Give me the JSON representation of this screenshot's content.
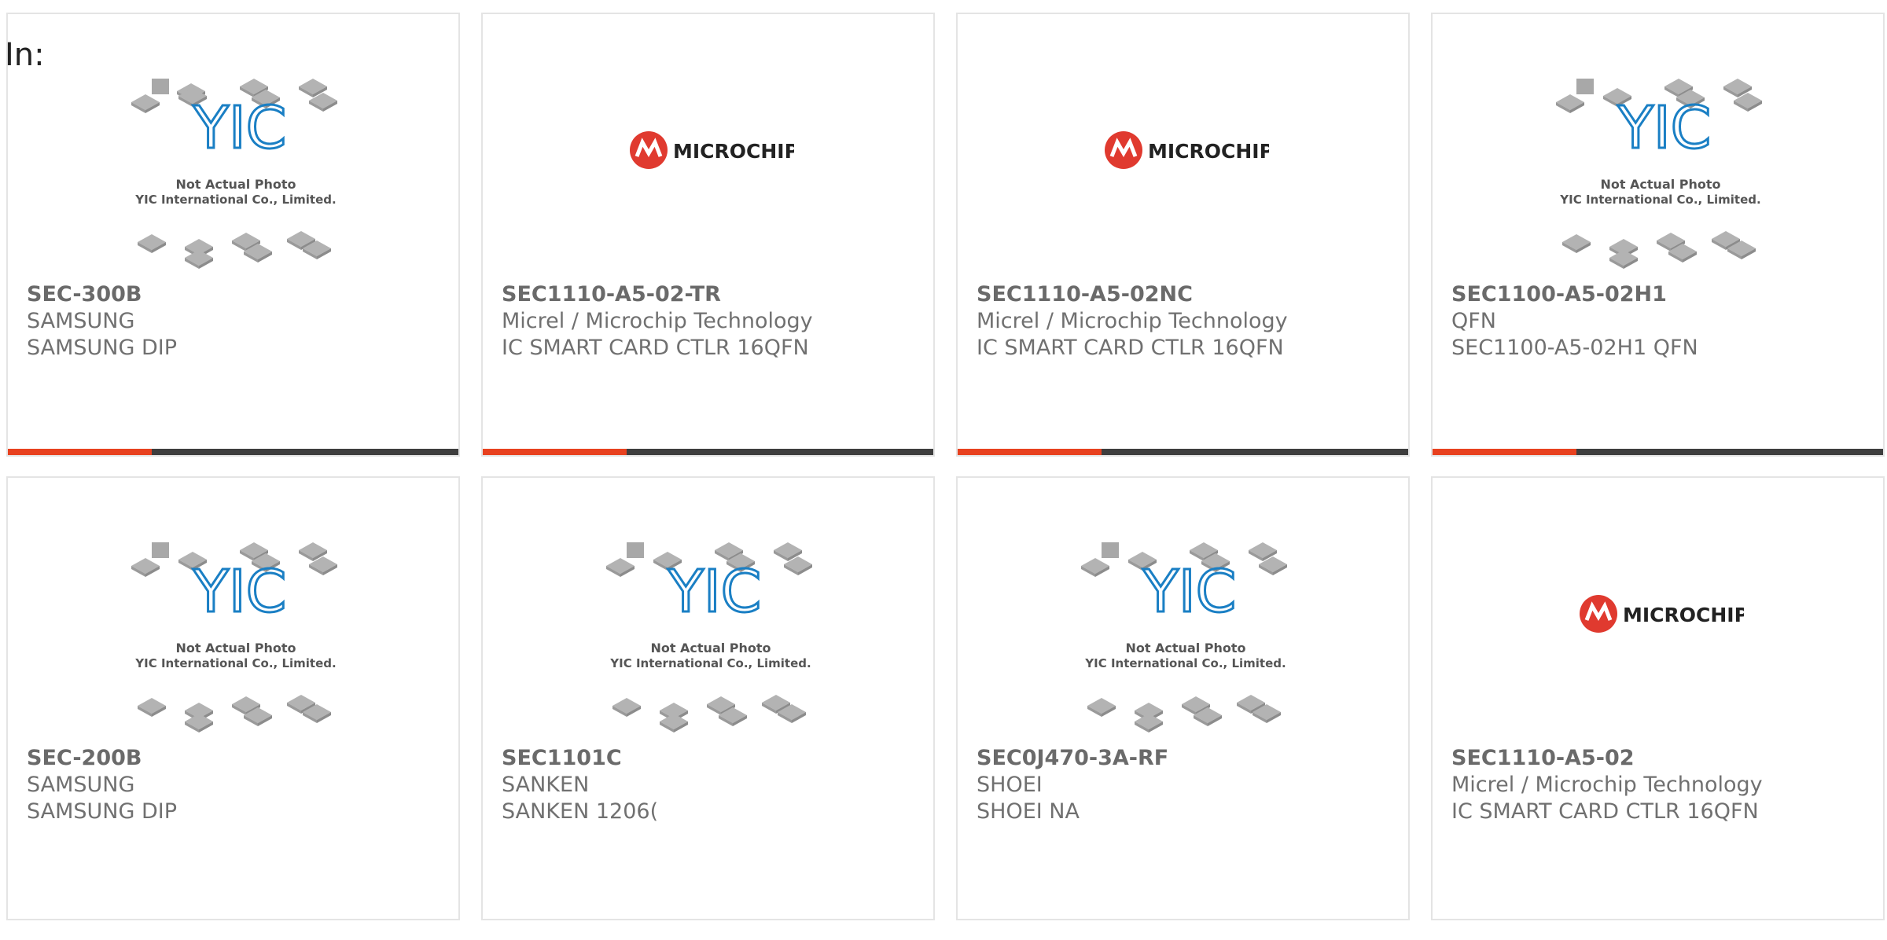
{
  "header": {
    "label": "In:"
  },
  "images": {
    "yic_line1": "Not Actual Photo",
    "yic_line2": "YIC International Co., Limited.",
    "microchip": "MICROCHIP"
  },
  "colors": {
    "accent": "#e8411f",
    "bar": "#3e3e3e",
    "microchip_red": "#e03a2f",
    "yic_blue": "#1a7fc4"
  },
  "products": [
    {
      "part": "SEC-300B",
      "maker": "SAMSUNG",
      "desc": "SAMSUNG DIP",
      "image": "yic-placeholder"
    },
    {
      "part": "SEC1110-A5-02-TR",
      "maker": "Micrel / Microchip Technology",
      "desc": "IC SMART CARD CTLR 16QFN",
      "image": "microchip-logo"
    },
    {
      "part": "SEC1110-A5-02NC",
      "maker": "Micrel / Microchip Technology",
      "desc": "IC SMART CARD CTLR 16QFN",
      "image": "microchip-logo"
    },
    {
      "part": "SEC1100-A5-02H1",
      "maker": "QFN",
      "desc": "SEC1100-A5-02H1 QFN",
      "image": "yic-placeholder"
    },
    {
      "part": "SEC-200B",
      "maker": "SAMSUNG",
      "desc": "SAMSUNG DIP",
      "image": "yic-placeholder"
    },
    {
      "part": "SEC1101C",
      "maker": "SANKEN",
      "desc": "SANKEN 1206(",
      "image": "yic-placeholder"
    },
    {
      "part": "SEC0J470-3A-RF",
      "maker": "SHOEI",
      "desc": "SHOEI NA",
      "image": "yic-placeholder"
    },
    {
      "part": "SEC1110-A5-02",
      "maker": "Micrel / Microchip Technology",
      "desc": "IC SMART CARD CTLR 16QFN",
      "image": "microchip-logo"
    }
  ]
}
